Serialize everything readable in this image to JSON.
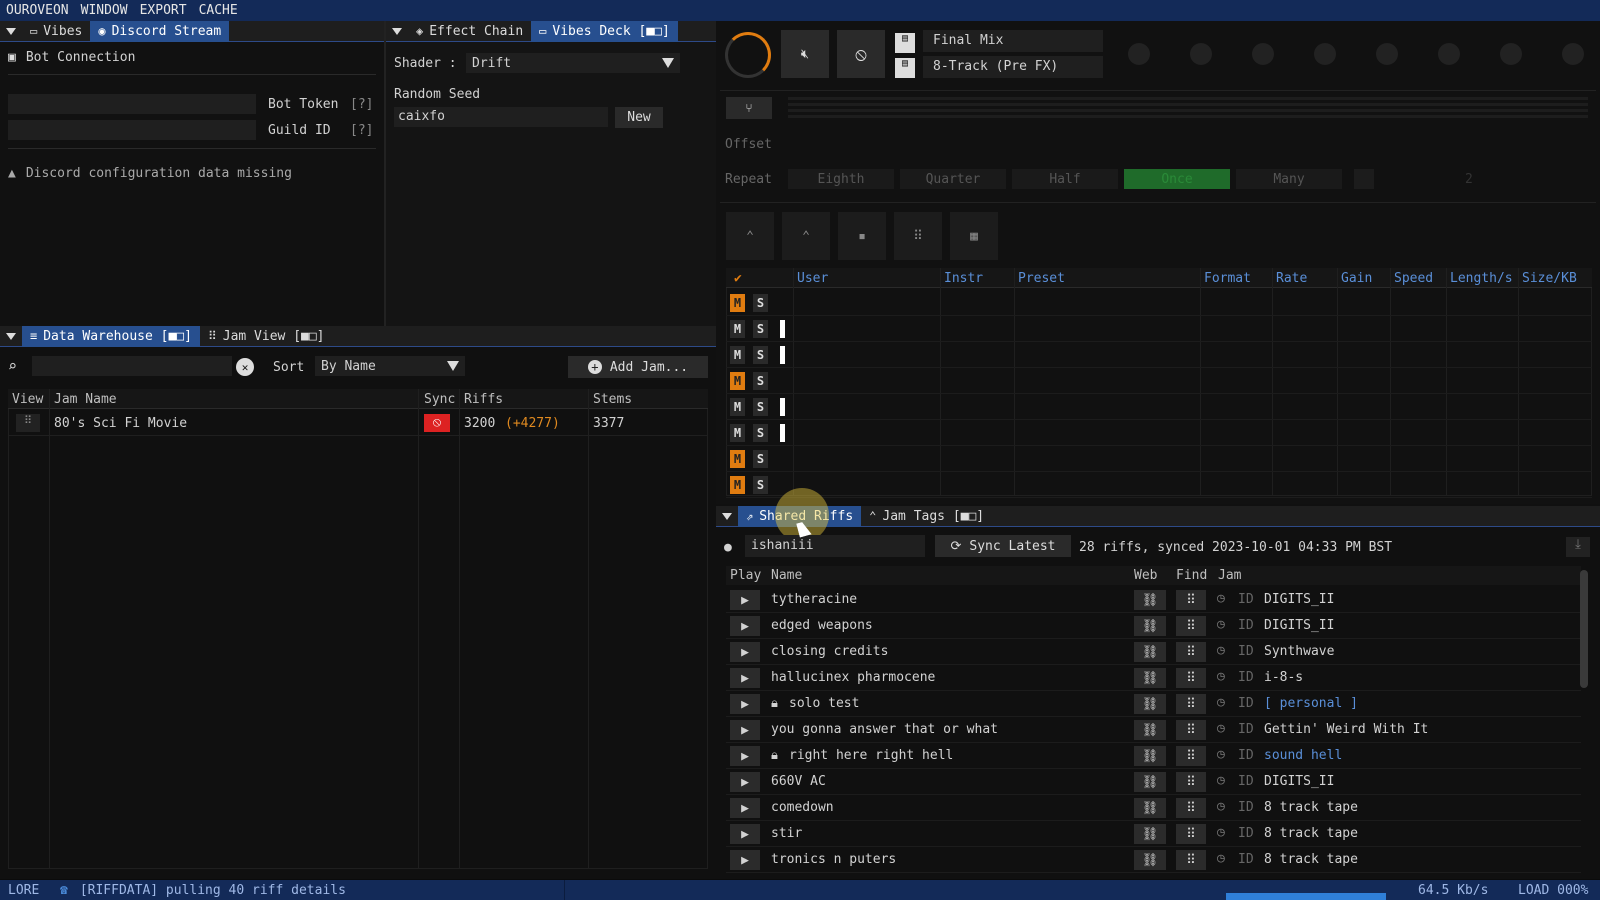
{
  "menu": [
    "OUROVEON",
    "WINDOW",
    "EXPORT",
    "CACHE"
  ],
  "left_top": {
    "tabs": [
      {
        "label": "Vibes",
        "icon": "monitor-icon"
      },
      {
        "label": "Discord Stream",
        "icon": "discord-icon"
      }
    ],
    "section_title": "Bot Connection",
    "bot_token_label": "Bot Token",
    "guild_id_label": "Guild ID",
    "help": "[?]",
    "warning": "Discord configuration data missing"
  },
  "mid_top": {
    "tabs": [
      {
        "label": "Effect Chain",
        "icon": "effect-icon"
      },
      {
        "label": "Vibes Deck [■□]",
        "icon": "monitor-icon"
      }
    ],
    "shader_label": "Shader :",
    "shader_value": "Drift",
    "seed_label": "Random Seed",
    "seed_value": "caixfo",
    "new_button": "New"
  },
  "warehouse": {
    "tabs": [
      {
        "label": "Data Warehouse [■□]",
        "icon": "database-icon"
      },
      {
        "label": "Jam View [■□]",
        "icon": "grid-icon"
      }
    ],
    "sort_label": "Sort",
    "sort_value": "By Name",
    "add_jam": "Add Jam...",
    "columns": [
      "View",
      "Jam Name",
      "Sync",
      "Riffs",
      "Stems"
    ],
    "rows": [
      {
        "name": "80's Sci Fi Movie",
        "riffs": "3200",
        "riffs_delta": "(+4277)",
        "stems": "3377"
      }
    ]
  },
  "mixer": {
    "final_mix": "Final Mix",
    "eight_track": "8-Track (Pre FX)",
    "offset_label": "Offset",
    "repeat_label": "Repeat",
    "repeat_options": [
      "Eighth",
      "Quarter",
      "Half",
      "Once",
      "Many"
    ],
    "repeat_selected": "Once",
    "repeat_count": "2"
  },
  "tracks": {
    "columns": [
      "User",
      "Instr",
      "Preset",
      "Format",
      "Rate",
      "Gain",
      "Speed",
      "Length/s",
      "Size/KB"
    ],
    "rows": [
      {
        "mute_on": true,
        "bar": false
      },
      {
        "mute_on": false,
        "bar": true
      },
      {
        "mute_on": false,
        "bar": true
      },
      {
        "mute_on": true,
        "bar": false
      },
      {
        "mute_on": false,
        "bar": true
      },
      {
        "mute_on": false,
        "bar": true
      },
      {
        "mute_on": true,
        "bar": false
      },
      {
        "mute_on": true,
        "bar": false
      }
    ],
    "m_label": "M",
    "s_label": "S"
  },
  "shared": {
    "tabs": [
      {
        "label": "Shared Riffs",
        "icon": "share-icon"
      },
      {
        "label": "Jam Tags [■□]",
        "icon": "chevrons-up-icon"
      }
    ],
    "user": "ishaniii",
    "sync_button": "Sync Latest",
    "sync_status": "28 riffs, synced 2023-10-01 04:33 PM BST",
    "columns": [
      "Play",
      "Name",
      "Web",
      "Find",
      "Jam"
    ],
    "id_label": "ID",
    "rows": [
      {
        "name": "tytheracine",
        "locked": false,
        "jam": "DIGITS_II",
        "private": false
      },
      {
        "name": "edged weapons",
        "locked": false,
        "jam": "DIGITS_II",
        "private": false
      },
      {
        "name": "closing credits",
        "locked": false,
        "jam": "Synthwave",
        "private": false
      },
      {
        "name": "hallucinex pharmocene",
        "locked": false,
        "jam": "i-8-s",
        "private": false
      },
      {
        "name": "solo test",
        "locked": true,
        "jam": "[ personal ]",
        "private": true
      },
      {
        "name": "you gonna answer that or what",
        "locked": false,
        "jam": "Gettin' Weird With It",
        "private": false
      },
      {
        "name": "right here right hell",
        "locked": true,
        "jam": "sound hell",
        "private": true
      },
      {
        "name": "660V AC",
        "locked": false,
        "jam": "DIGITS_II",
        "private": false
      },
      {
        "name": "comedown",
        "locked": false,
        "jam": "8 track tape",
        "private": false
      },
      {
        "name": "stir",
        "locked": false,
        "jam": "8 track tape",
        "private": false
      },
      {
        "name": "tronics n puters",
        "locked": false,
        "jam": "8 track tape",
        "private": false
      }
    ]
  },
  "status": {
    "left": "LORE",
    "message": "[RIFFDATA] pulling 40 riff details",
    "rate": "64.5 Kb/s",
    "load": "LOAD 000%"
  },
  "colors": {
    "accent": "#274f8f",
    "orange": "#e07c10",
    "green": "#1f6b2a",
    "link": "#5a8fd8"
  }
}
